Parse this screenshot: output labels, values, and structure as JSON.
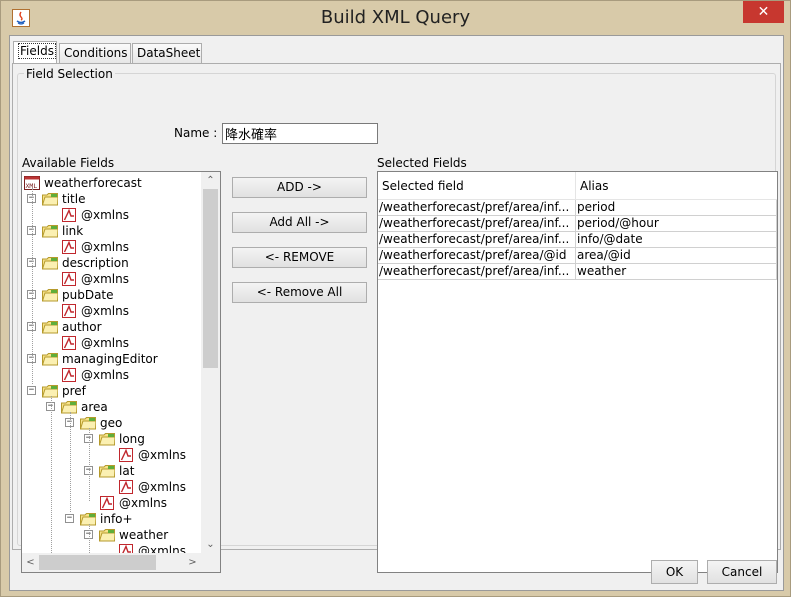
{
  "window": {
    "title": "Build XML Query",
    "close_glyph": "✕"
  },
  "tabs": [
    {
      "label": "Fields",
      "active": true
    },
    {
      "label": "Conditions",
      "active": false
    },
    {
      "label": "DataSheet",
      "active": false
    }
  ],
  "field_selection": {
    "group_label": "Field Selection",
    "name_label": "Name :",
    "name_value": "降水確率"
  },
  "available_fields": {
    "label": "Available Fields",
    "tree": [
      {
        "label": "weatherforecast",
        "icon": "xml-root-icon",
        "level": 0,
        "expander": ""
      },
      {
        "label": "title",
        "icon": "folder-icon",
        "level": 1,
        "expander": "−"
      },
      {
        "label": "@xmlns",
        "icon": "attribute-icon",
        "level": 2,
        "expander": ""
      },
      {
        "label": "link",
        "icon": "folder-icon",
        "level": 1,
        "expander": "−"
      },
      {
        "label": "@xmlns",
        "icon": "attribute-icon",
        "level": 2,
        "expander": ""
      },
      {
        "label": "description",
        "icon": "folder-icon",
        "level": 1,
        "expander": "−"
      },
      {
        "label": "@xmlns",
        "icon": "attribute-icon",
        "level": 2,
        "expander": ""
      },
      {
        "label": "pubDate",
        "icon": "folder-icon",
        "level": 1,
        "expander": "−"
      },
      {
        "label": "@xmlns",
        "icon": "attribute-icon",
        "level": 2,
        "expander": ""
      },
      {
        "label": "author",
        "icon": "folder-icon",
        "level": 1,
        "expander": "−"
      },
      {
        "label": "@xmlns",
        "icon": "attribute-icon",
        "level": 2,
        "expander": ""
      },
      {
        "label": "managingEditor",
        "icon": "folder-icon",
        "level": 1,
        "expander": "−"
      },
      {
        "label": "@xmlns",
        "icon": "attribute-icon",
        "level": 2,
        "expander": ""
      },
      {
        "label": "pref",
        "icon": "folder-icon",
        "level": 1,
        "expander": "−"
      },
      {
        "label": "area",
        "icon": "folder-icon",
        "level": 2,
        "expander": "−"
      },
      {
        "label": "geo",
        "icon": "folder-icon",
        "level": 3,
        "expander": "−"
      },
      {
        "label": "long",
        "icon": "folder-icon",
        "level": 4,
        "expander": "−"
      },
      {
        "label": "@xmlns",
        "icon": "attribute-icon",
        "level": 5,
        "expander": ""
      },
      {
        "label": "lat",
        "icon": "folder-icon",
        "level": 4,
        "expander": "−"
      },
      {
        "label": "@xmlns",
        "icon": "attribute-icon",
        "level": 5,
        "expander": ""
      },
      {
        "label": "@xmlns",
        "icon": "attribute-icon",
        "level": 4,
        "expander": ""
      },
      {
        "label": "info+",
        "icon": "folder-icon",
        "level": 3,
        "expander": "−"
      },
      {
        "label": "weather",
        "icon": "folder-icon",
        "level": 4,
        "expander": "−"
      },
      {
        "label": "@xmlns",
        "icon": "attribute-icon",
        "level": 5,
        "expander": ""
      }
    ],
    "scroll_up": "⌃",
    "scroll_down": "⌄",
    "scroll_left": "<",
    "scroll_right": ">"
  },
  "actions": {
    "add": "ADD ->",
    "add_all": "Add All ->",
    "remove": "<- REMOVE",
    "remove_all": "<- Remove All"
  },
  "selected_fields": {
    "label": "Selected Fields",
    "columns": [
      "Selected field",
      "Alias"
    ],
    "rows": [
      [
        "/weatherforecast/pref/area/inf...",
        "period"
      ],
      [
        "/weatherforecast/pref/area/inf...",
        "period/@hour"
      ],
      [
        "/weatherforecast/pref/area/inf...",
        "info/@date"
      ],
      [
        "/weatherforecast/pref/area/@id",
        "area/@id"
      ],
      [
        "/weatherforecast/pref/area/inf...",
        "weather"
      ]
    ]
  },
  "footer": {
    "ok": "OK",
    "cancel": "Cancel"
  }
}
